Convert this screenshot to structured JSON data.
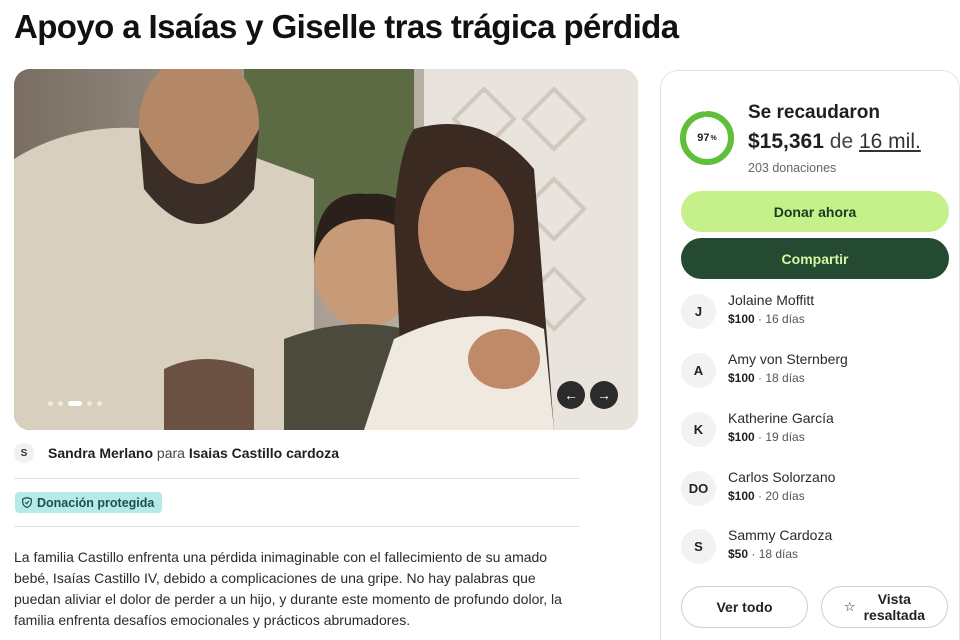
{
  "page": {
    "title": "Apoyo a Isaías y Giselle tras trágica pérdida"
  },
  "gallery": {
    "prev_icon": "←",
    "next_icon": "→",
    "slide_count": 5,
    "active_slide": 3
  },
  "organizer": {
    "avatar_initial": "S",
    "name": "Sandra Merlano",
    "connector": "para",
    "beneficiary": "Isaias Castillo cardoza"
  },
  "badge": {
    "label": "Donación protegida",
    "icon": "shield-icon"
  },
  "story": {
    "text": "La familia Castillo enfrenta una pérdida inimaginable con el fallecimiento de su amado bebé, Isaías Castillo IV, debido a complicaciones de una gripe. No hay palabras que puedan aliviar el dolor de perder a un hijo, y durante este momento de profundo dolor, la familia enfrenta desafíos emocionales y prácticos abrumadores."
  },
  "donation_card": {
    "progress_percent": 97,
    "progress_label": "97",
    "progress_unit": "%",
    "raised_label": "Se recaudaron",
    "raised_amount": "$15,361",
    "of_word": "de",
    "goal": "16 mil.",
    "donation_count": "203 donaciones",
    "donate_button": "Donar ahora",
    "share_button": "Compartir",
    "see_all_button": "Ver todo",
    "featured_button_line1": "Vista",
    "featured_button_line2": "resaltada",
    "featured_icon": "☆",
    "colors": {
      "donate_bg": "#c5f08a",
      "share_bg": "#244a31",
      "progress": "#5fbf3b"
    }
  },
  "donors": [
    {
      "initial": "J",
      "name": "Jolaine Moffitt",
      "amount": "$100",
      "time": " · 16 días"
    },
    {
      "initial": "A",
      "name": "Amy von Sternberg",
      "amount": "$100",
      "time": " · 18 días"
    },
    {
      "initial": "K",
      "name": "Katherine García",
      "amount": "$100",
      "time": " · 19 días"
    },
    {
      "initial": "DO",
      "name": "Carlos Solorzano",
      "amount": "$100",
      "time": " · 20 días"
    },
    {
      "initial": "S",
      "name": "Sammy Cardoza",
      "amount": "$50",
      "time": " · 18 días"
    }
  ]
}
